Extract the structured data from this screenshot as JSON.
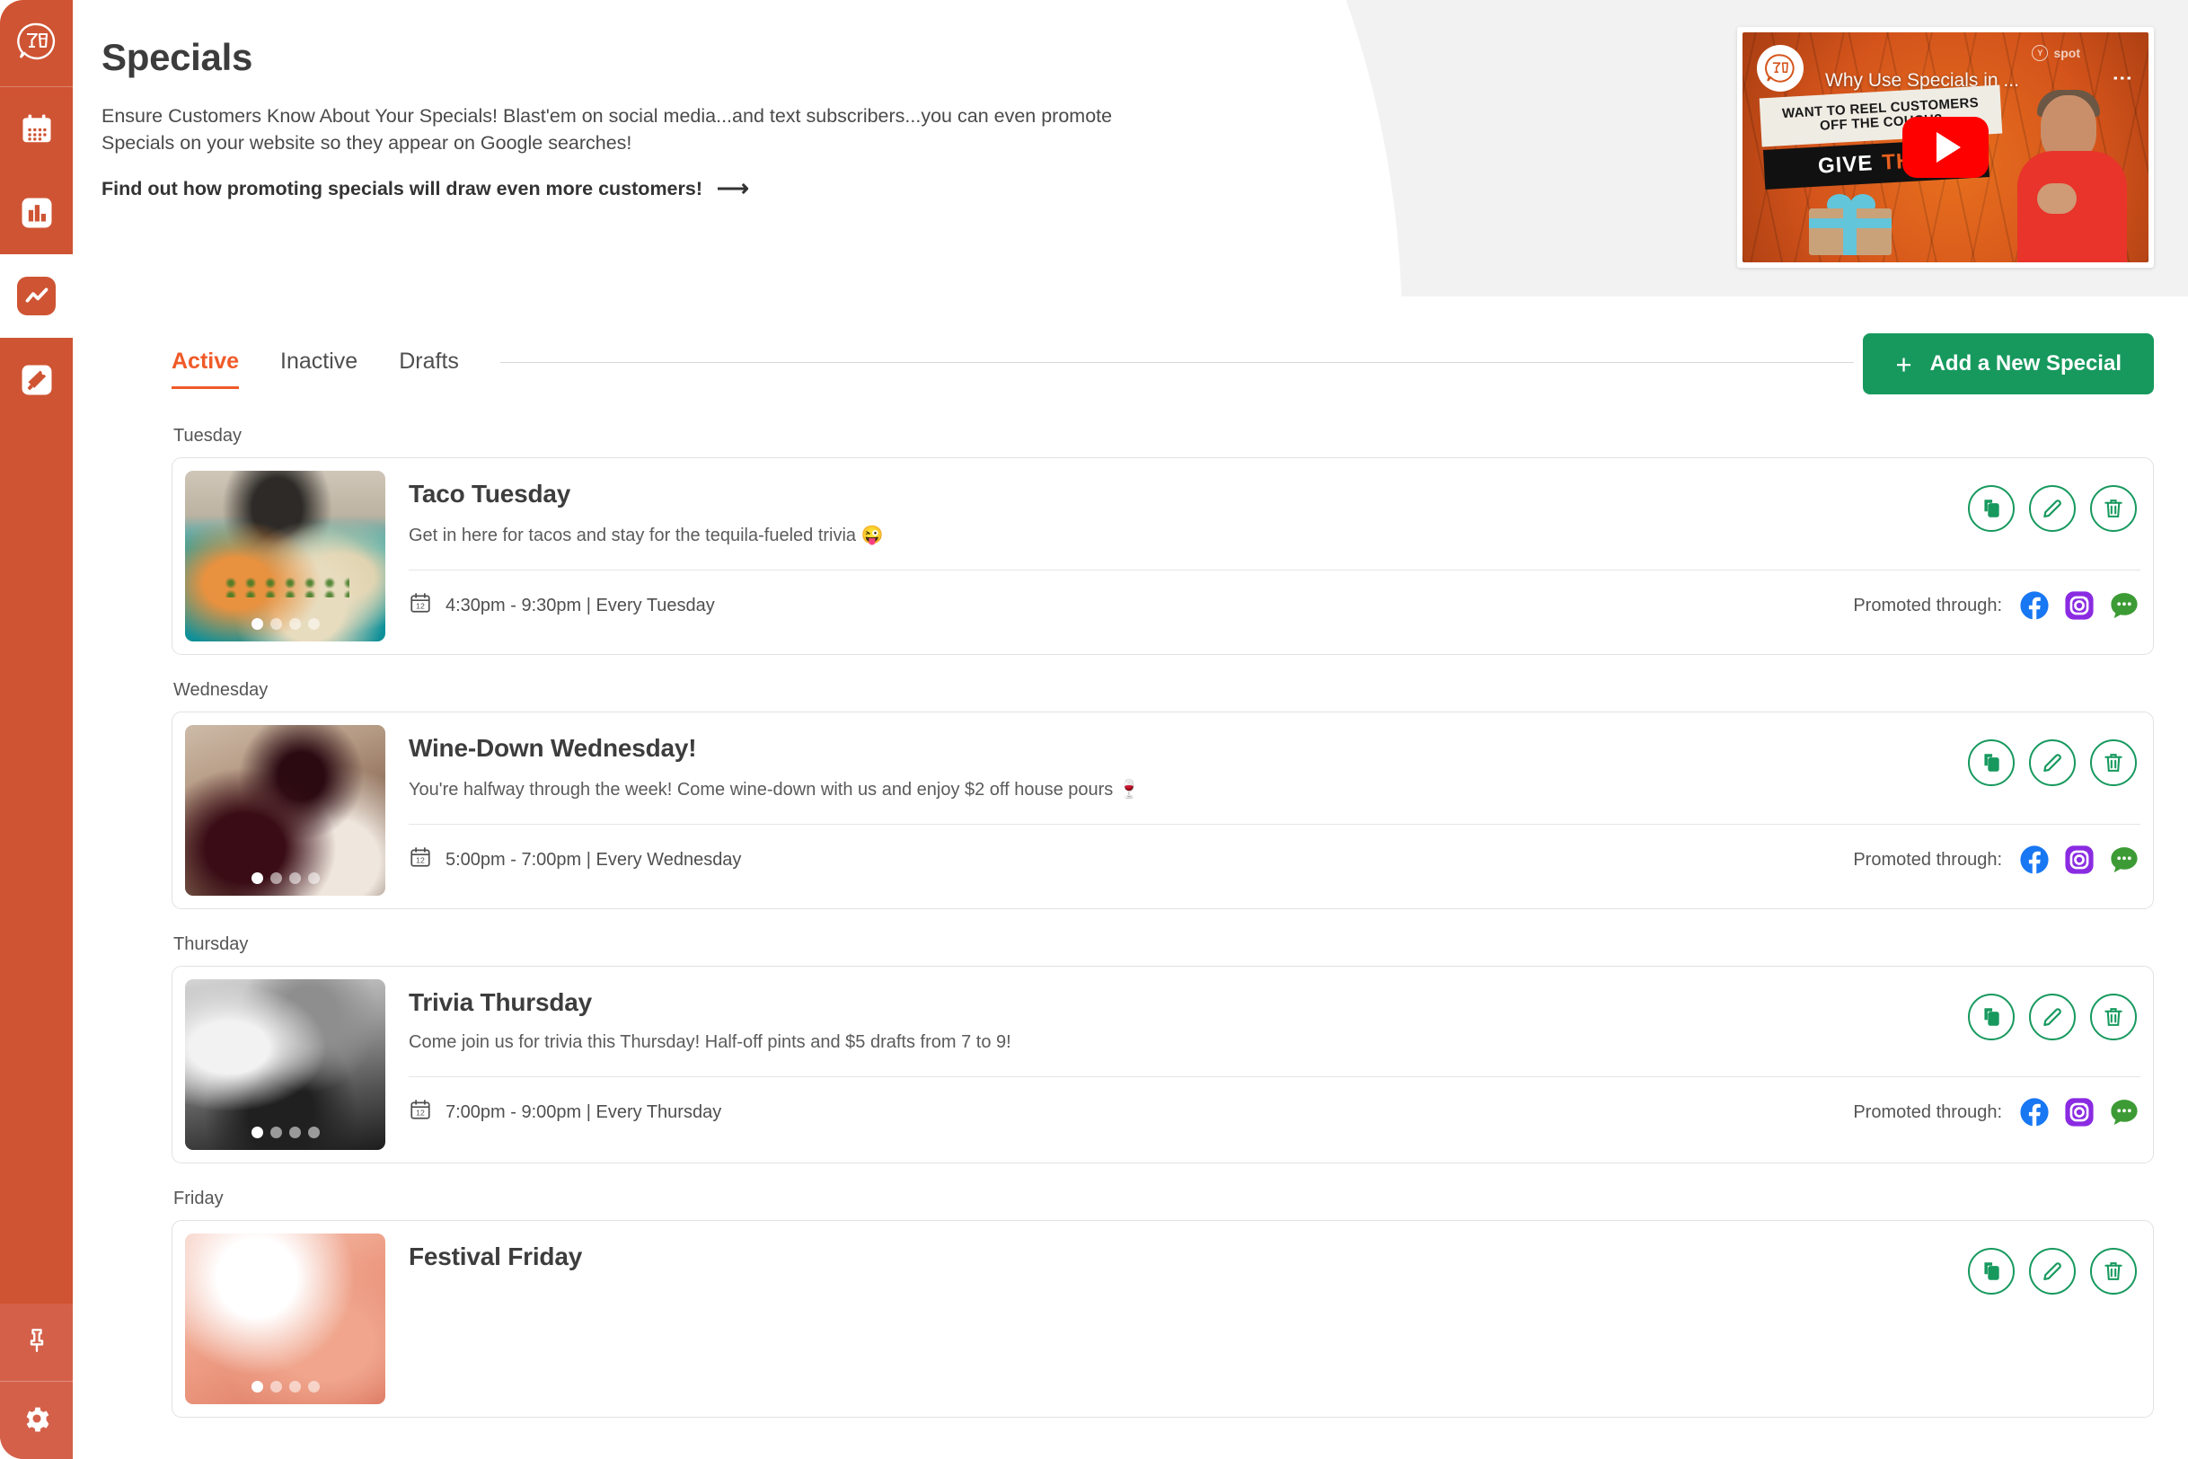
{
  "sidebar": {
    "logo": {
      "name": "spot-logo-icon",
      "alt": "cocktail and beer glasses logo"
    },
    "items": [
      {
        "id": "calendar",
        "icon": "calendar-icon",
        "active": false
      },
      {
        "id": "analytics",
        "icon": "bar-chart-icon",
        "active": false
      },
      {
        "id": "trends",
        "icon": "trending-line-icon",
        "active": true
      },
      {
        "id": "promotions",
        "icon": "megaphone-icon",
        "active": false
      }
    ],
    "footer_items": [
      {
        "id": "pin",
        "icon": "pin-icon"
      },
      {
        "id": "settings",
        "icon": "gear-icon"
      }
    ]
  },
  "hero": {
    "title": "Specials",
    "subtitle": "Ensure Customers Know About Your Specials! Blast'em on social media...and text subscribers...you can even promote Specials on your website so they appear on Google searches!",
    "cta": "Find out how promoting specials will draw even more customers!",
    "cta_arrow": "⟶",
    "video": {
      "title": "Why Use Specials in ...",
      "brand": "spot",
      "overlay_line1": "WANT TO REEL CUSTOMERS",
      "overlay_line2": "OFF THE COUCH?",
      "overlay_band_word1": "GIVE",
      "overlay_band_word2": "THIS",
      "kebab": "⋮"
    }
  },
  "tabs": [
    {
      "label": "Active",
      "active": true
    },
    {
      "label": "Inactive",
      "active": false
    },
    {
      "label": "Drafts",
      "active": false
    }
  ],
  "add_button": {
    "label": "Add a New Special",
    "plus": "+"
  },
  "labels": {
    "promoted_through": "Promoted through:"
  },
  "colors": {
    "brand_orange": "#cf5433",
    "accent_orange": "#f05a28",
    "green": "#17995e",
    "facebook": "#1877f2",
    "instagram": "#8a2be2",
    "sms_green": "#3d9b35"
  },
  "groups": [
    {
      "day": "Tuesday",
      "special": {
        "title": "Taco Tuesday",
        "description": "Get in here for tacos and stay for the tequila-fueled trivia 😜",
        "schedule": "4:30pm - 9:30pm | Every Tuesday",
        "image_style": "tacos",
        "dots": 4,
        "active_dot": 0,
        "promoted": [
          "facebook-icon",
          "instagram-icon",
          "sms-icon"
        ],
        "actions": [
          "duplicate-icon",
          "edit-icon",
          "delete-icon"
        ]
      }
    },
    {
      "day": "Wednesday",
      "special": {
        "title": "Wine-Down Wednesday!",
        "description": "You're halfway through the week! Come wine-down with us and enjoy $2 off house pours 🍷",
        "schedule": "5:00pm - 7:00pm | Every Wednesday",
        "image_style": "wine",
        "dots": 4,
        "active_dot": 0,
        "promoted": [
          "facebook-icon",
          "instagram-icon",
          "sms-icon"
        ],
        "actions": [
          "duplicate-icon",
          "edit-icon",
          "delete-icon"
        ]
      }
    },
    {
      "day": "Thursday",
      "special": {
        "title": "Trivia Thursday",
        "description": "Come join us for trivia this Thursday! Half-off pints and $5 drafts from 7 to 9!",
        "schedule": "7:00pm - 9:00pm | Every Thursday",
        "image_style": "trivia",
        "dots": 4,
        "active_dot": 0,
        "promoted": [
          "facebook-icon",
          "instagram-icon",
          "sms-icon"
        ],
        "actions": [
          "duplicate-icon",
          "edit-icon",
          "delete-icon"
        ]
      }
    },
    {
      "day": "Friday",
      "special": {
        "title": "Festival Friday",
        "description": "",
        "schedule": "",
        "image_style": "festival",
        "dots": 4,
        "active_dot": 0,
        "promoted": [
          "facebook-icon",
          "instagram-icon",
          "sms-icon"
        ],
        "actions": [
          "duplicate-icon",
          "edit-icon",
          "delete-icon"
        ]
      }
    }
  ]
}
